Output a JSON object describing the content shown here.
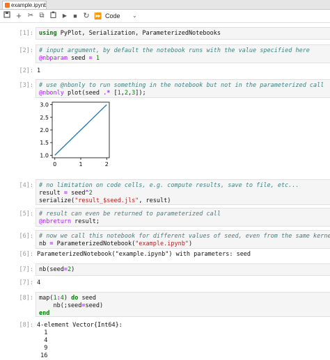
{
  "tab": {
    "title": "example.ipynb"
  },
  "toolbar": {
    "save_icon": "💾",
    "add_icon": "+",
    "cut_icon": "✂",
    "copy_icon": "⧉",
    "paste_icon": "📋",
    "run_icon": "▶",
    "stop_icon": "■",
    "restart_icon": "↻",
    "run_all_icon": "⏩",
    "cell_type": "Code",
    "caret": "⌄"
  },
  "cells": {
    "c1": {
      "prompt": "[1]:",
      "l1_kw": "using",
      "l1_rest": " PyPlot, Serialization, ParameterizedNotebooks"
    },
    "c2": {
      "prompt": "[2]:",
      "comment": "# input argument, by default the notebook runs with the value specified here",
      "macro": "@nbparam",
      "rest_a": " seed ",
      "eq": "=",
      "num": " 1"
    },
    "o2": {
      "prompt": "[2]:",
      "text": "1"
    },
    "c3": {
      "prompt": "[3]:",
      "comment": "# use @nbonly to run something in the notebook but not in the parameterized call",
      "macro": "@nbonly",
      "rest_a": " plot(seed ",
      "op": ".*",
      "rest_b": " [",
      "n1": "1",
      "c1": ",",
      "n2": "2",
      "c2": ",",
      "n3": "3",
      "rest_c": "]);"
    },
    "c4": {
      "prompt": "[4]:",
      "comment": "# no limitation on code cells, e.g. compute results, save to file, etc...",
      "l2a": "result ",
      "l2eq": "=",
      "l2b": " seed",
      "l2op": "^",
      "l2n": "2",
      "l3a": "serialize(",
      "l3s": "\"result_$seed.jls\"",
      "l3b": ", result)"
    },
    "c5": {
      "prompt": "[5]:",
      "comment": "# result can even be returned to parameterized call",
      "macro": "@nbreturn",
      "rest": " result;"
    },
    "c6": {
      "prompt": "[6]:",
      "comment": "# now we call this notebook for different values of seed, even from the same kernel/notebook",
      "l2a": "nb ",
      "l2eq": "=",
      "l2b": " ParameterizedNotebook(",
      "l2s": "\"example.ipynb\"",
      "l2c": ")"
    },
    "o6": {
      "prompt": "[6]:",
      "text": "ParameterizedNotebook(\"example.ipynb\") with parameters: seed"
    },
    "c7": {
      "prompt": "[7]:",
      "a": "nb(seed",
      "eq": "=",
      "n": "2",
      "b": ")"
    },
    "o7": {
      "prompt": "[7]:",
      "text": "4"
    },
    "c8": {
      "prompt": "[8]:",
      "l1a": "map(",
      "l1n1": "1",
      "l1c": ":",
      "l1n2": "4",
      "l1b": ") ",
      "l1kw": "do",
      "l1c2": " seed",
      "l2a": "    nb(;seed",
      "l2eq": "=",
      "l2b": "seed)",
      "l3kw": "end"
    },
    "o8": {
      "prompt": "[8]:",
      "l1": "4-element Vector{Int64}:",
      "l2": "  1",
      "l3": "  4",
      "l4": "  9",
      "l5": " 16"
    }
  },
  "chart_data": {
    "type": "line",
    "x": [
      0,
      1,
      2
    ],
    "series": [
      {
        "values": [
          1,
          2,
          3
        ]
      }
    ],
    "xlim": [
      -0.1,
      2.1
    ],
    "ylim": [
      0.9,
      3.1
    ],
    "xticks": [
      "0",
      "1",
      "2"
    ],
    "yticks": [
      "1.0",
      "1.5",
      "2.0",
      "2.5",
      "3.0"
    ],
    "line_color": "#1f77b4",
    "grid": false
  }
}
